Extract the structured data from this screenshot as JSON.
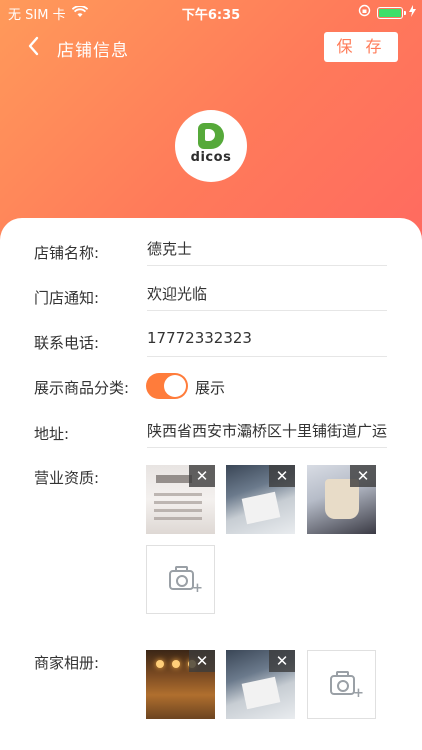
{
  "status_bar": {
    "carrier": "无 SIM 卡",
    "time": "下午6:35",
    "battery_color": "#3ee06a"
  },
  "nav": {
    "title": "店铺信息",
    "save_label": "保 存",
    "back_icon": "chevron-left-icon"
  },
  "store": {
    "logo_text": "dicos",
    "brand_color": "#56a93a"
  },
  "form": {
    "name": {
      "label": "店铺名称:",
      "value": "德克士"
    },
    "notice": {
      "label": "门店通知:",
      "value": "欢迎光临"
    },
    "phone": {
      "label": "联系电话:",
      "value": "17772332323"
    },
    "category": {
      "label": "展示商品分类:",
      "toggle_on": true,
      "toggle_label": "展示"
    },
    "address": {
      "label": "地址:",
      "value": "陕西省西安市灞桥区十里铺街道广运"
    },
    "qualification": {
      "label": "营业资质:",
      "images": [
        "business-license-photo",
        "desk-photo",
        "paper-cup-photo"
      ]
    },
    "album": {
      "label": "商家相册:",
      "images": [
        "restaurant-interior-photo",
        "desk-photo"
      ]
    }
  },
  "theme": {
    "accent": "#ff7c3b",
    "gradient_start": "#ff9a5a",
    "gradient_end": "#ff6a60"
  }
}
